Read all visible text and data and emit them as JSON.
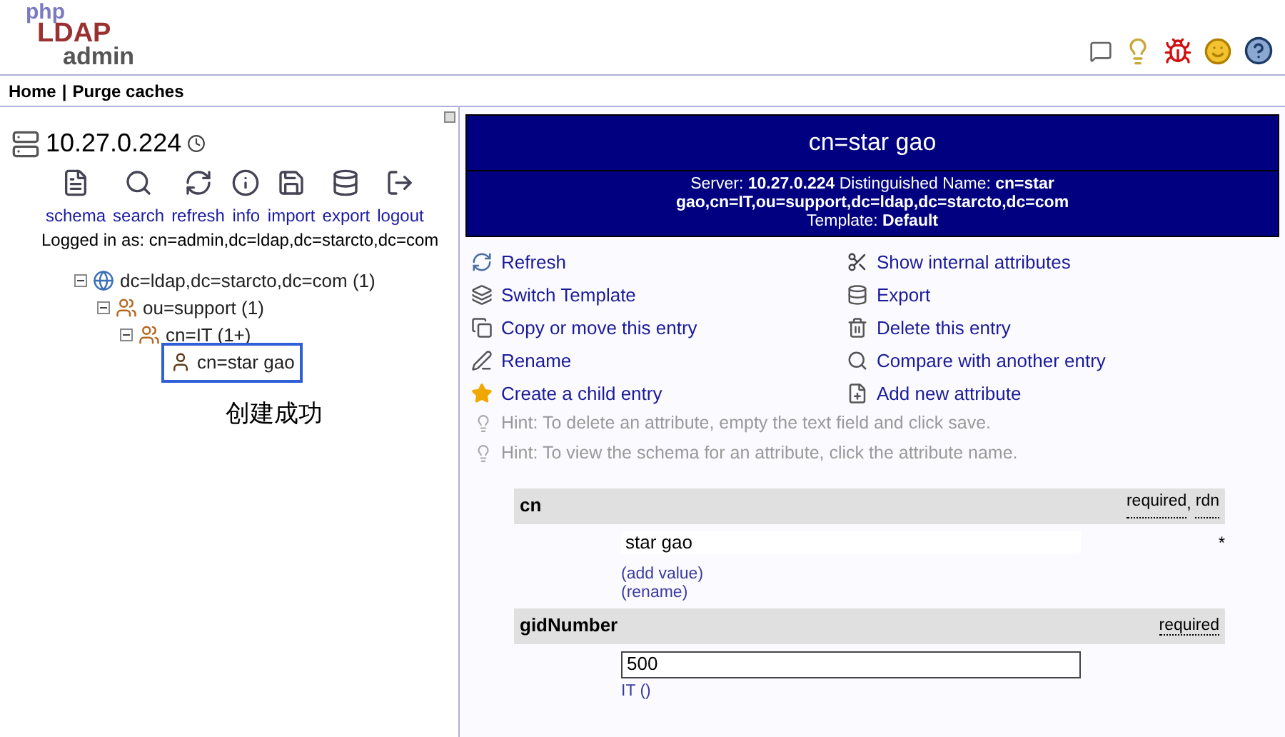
{
  "logo": {
    "parts": [
      "php",
      "LDAP",
      "admin"
    ]
  },
  "nav": {
    "items": [
      "Home",
      "Purge caches"
    ],
    "separator": "|"
  },
  "server": {
    "name": "10.27.0.224"
  },
  "tools": [
    {
      "kind": "schema",
      "label": "schema"
    },
    {
      "kind": "search",
      "label": "search"
    },
    {
      "kind": "refresh",
      "label": "refresh"
    },
    {
      "kind": "info",
      "label": "info"
    },
    {
      "kind": "import",
      "label": "import"
    },
    {
      "kind": "export",
      "label": "export"
    },
    {
      "kind": "logout",
      "label": "logout"
    }
  ],
  "logged_in": "Logged in as: cn=admin,dc=ldap,dc=starcto,dc=com",
  "tree": [
    {
      "kind": "domain",
      "label": "dc=ldap,dc=starcto,dc=com (1)",
      "selected": false,
      "children": [
        {
          "kind": "group",
          "label": "ou=support (1)",
          "selected": false,
          "children": [
            {
              "kind": "group",
              "label": "cn=IT (1+)",
              "selected": false,
              "children": [
                {
                  "kind": "person",
                  "label": "cn=star gao",
                  "selected": true
                }
              ]
            }
          ]
        }
      ]
    }
  ],
  "note": "创建成功",
  "entry": {
    "title": "cn=star gao",
    "info_lines": [
      "Server: **10.27.0.224**   Distinguished Name: **cn=star gao,cn=IT,ou=support,dc=ldap,dc=starcto,dc=com**",
      "Template: **Default**"
    ]
  },
  "actions": [
    {
      "kind": "refresh",
      "label": "Refresh"
    },
    {
      "kind": "tools",
      "label": "Show internal attributes"
    },
    {
      "kind": "template",
      "label": "Switch Template"
    },
    {
      "kind": "export",
      "label": "Export"
    },
    {
      "kind": "copy",
      "label": "Copy or move this entry"
    },
    {
      "kind": "delete",
      "label": "Delete this entry"
    },
    {
      "kind": "rename",
      "label": "Rename"
    },
    {
      "kind": "compare",
      "label": "Compare with another entry"
    },
    {
      "kind": "create",
      "label": "Create a child entry"
    },
    {
      "kind": "add",
      "label": "Add new attribute"
    }
  ],
  "hints": [
    "Hint: To delete an attribute, empty the text field and click save.",
    "Hint: To view the schema for an attribute, click the attribute name."
  ],
  "attributes": [
    {
      "name": "cn",
      "flags": [
        "required",
        "rdn"
      ],
      "flag_separator": ",",
      "values": [
        {
          "kind": "readonly",
          "value": "star gao"
        }
      ],
      "required_mark": "*",
      "links": [
        "(add value)",
        "(rename)"
      ]
    },
    {
      "name": "gidNumber",
      "flags": [
        "required"
      ],
      "values": [
        {
          "kind": "input",
          "value": "500"
        }
      ],
      "links": [
        "IT ()"
      ]
    }
  ]
}
